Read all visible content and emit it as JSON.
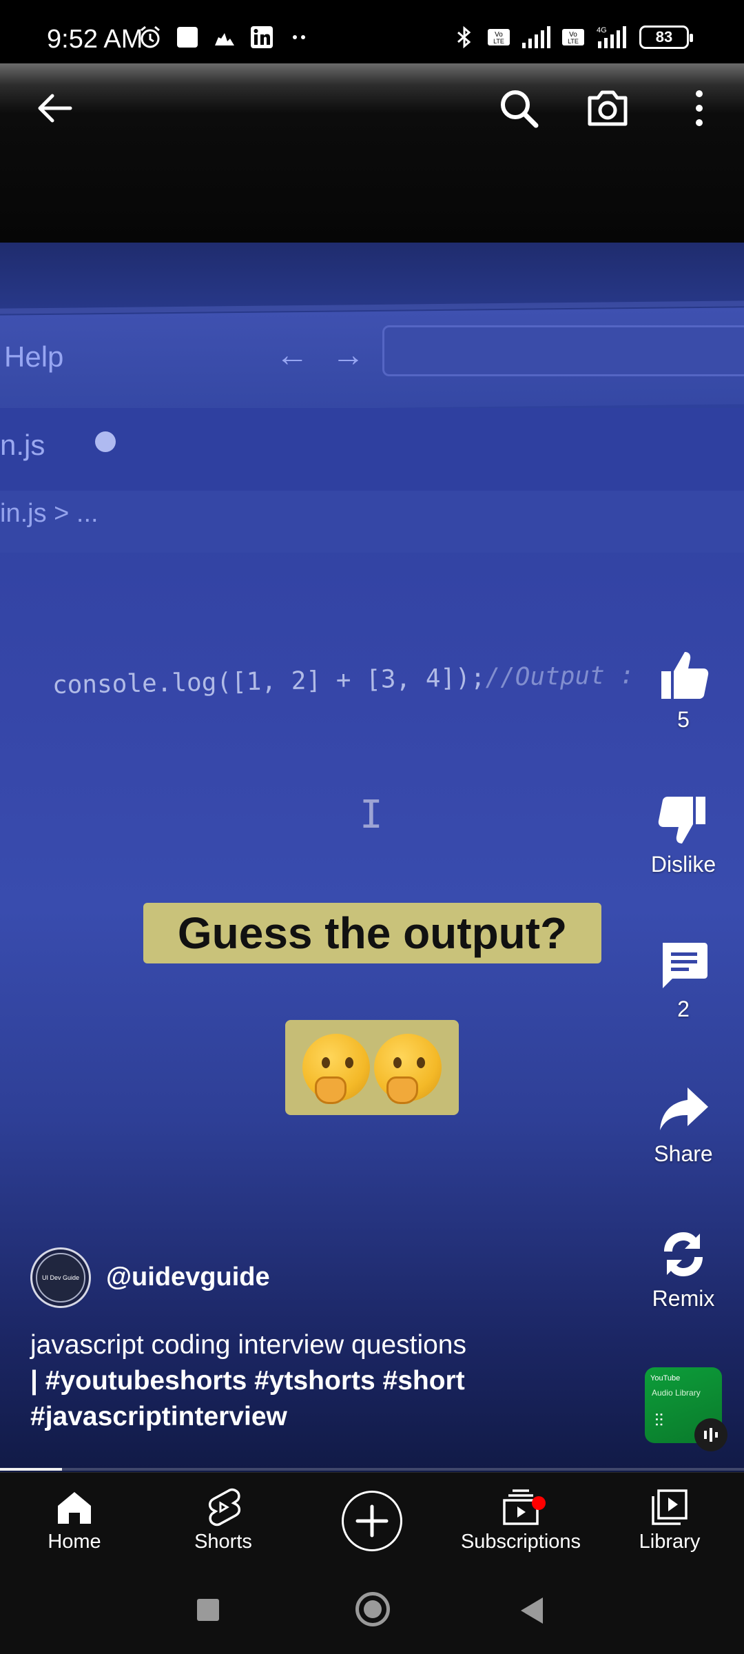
{
  "status_bar": {
    "time": "9:52 AM",
    "battery": "83",
    "icons": [
      "alarm-icon",
      "square-notification-icon",
      "cloud-icon",
      "linkedin-icon",
      "more-dots-icon",
      "bluetooth-icon",
      "volte-icon",
      "signal-icon",
      "volte-icon",
      "4g-signal-icon",
      "battery-icon"
    ]
  },
  "video": {
    "editor_menu": "Help",
    "nav_arrows": "← →",
    "tab_filename": "n.js",
    "breadcrumb": "in.js > ...",
    "code_line": "console.log([1, 2] + [3, 4]);",
    "code_comment": "//Output :",
    "overlay_text": "Guess the output?",
    "emoji": "🤔🤔"
  },
  "top_bar": {
    "back_icon": "arrow-left-icon",
    "search_icon": "search-icon",
    "camera_icon": "camera-icon",
    "more_icon": "more-vert-icon"
  },
  "actions": {
    "like_count": "5",
    "dislike_label": "Dislike",
    "comment_count": "2",
    "share_label": "Share",
    "remix_label": "Remix"
  },
  "channel": {
    "avatar_text": "UI Dev Guide",
    "handle": "@uidevguide"
  },
  "description": {
    "text": "javascript coding interview questions",
    "tags_line1": "| #youtubeshorts #ytshorts #short",
    "tags_line2": "#javascriptinterview"
  },
  "music": {
    "brand": "YouTube",
    "label": "Audio Library"
  },
  "progress": 0.083,
  "bottom_nav": {
    "home": "Home",
    "shorts": "Shorts",
    "subscriptions": "Subscriptions",
    "library": "Library"
  },
  "colors": {
    "accent_red": "#ff0000",
    "video_blue": "#3646a8",
    "caption_bg": "#c9c27a",
    "music_green": "#0d9d3a"
  }
}
